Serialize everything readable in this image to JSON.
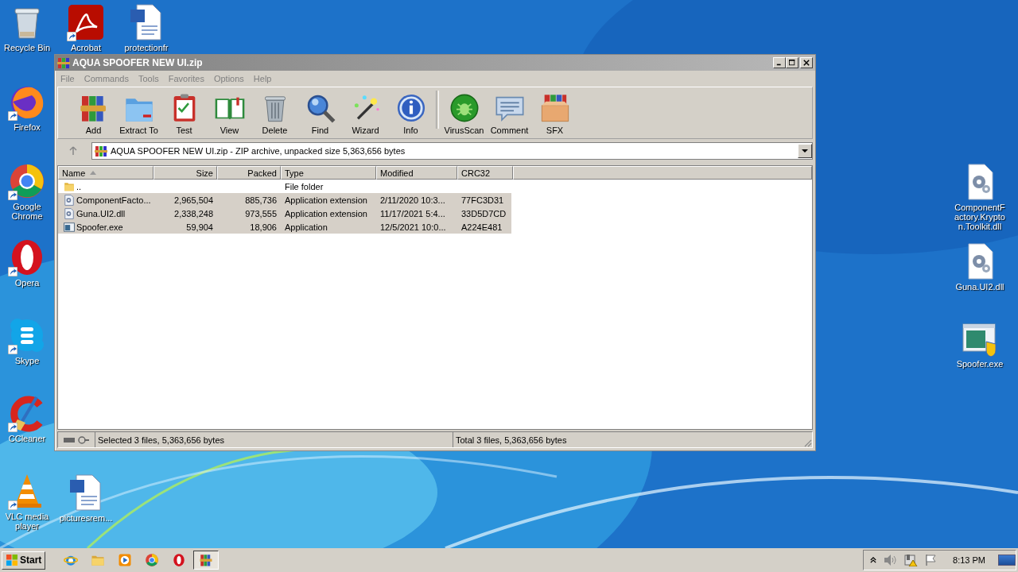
{
  "desktop": {
    "icons": [
      {
        "label": "Recycle Bin",
        "kind": "recycle",
        "shortcut": false
      },
      {
        "label": "Acrobat",
        "kind": "pdf",
        "shortcut": true
      },
      {
        "label": "protectionfr",
        "kind": "word",
        "shortcut": false
      },
      {
        "label": "Firefox",
        "kind": "firefox",
        "shortcut": true
      },
      {
        "label": "Google Chrome",
        "kind": "chrome",
        "shortcut": true
      },
      {
        "label": "Opera",
        "kind": "opera",
        "shortcut": true
      },
      {
        "label": "Skype",
        "kind": "skype",
        "shortcut": true
      },
      {
        "label": "CCleaner",
        "kind": "ccleaner",
        "shortcut": true
      },
      {
        "label": "VLC media player",
        "kind": "vlc",
        "shortcut": true
      },
      {
        "label": "picturesrem...",
        "kind": "word",
        "shortcut": false
      },
      {
        "label": "ComponentFactory.Krypton.Toolkit.dll",
        "kind": "dll",
        "shortcut": false
      },
      {
        "label": "Guna.UI2.dll",
        "kind": "dll",
        "shortcut": false
      },
      {
        "label": "Spoofer.exe",
        "kind": "exe",
        "shortcut": false
      }
    ]
  },
  "window": {
    "title": "AQUA SPOOFER NEW UI.zip",
    "menu": [
      "File",
      "Commands",
      "Tools",
      "Favorites",
      "Options",
      "Help"
    ],
    "toolbar": [
      {
        "label": "Add",
        "kind": "add"
      },
      {
        "label": "Extract To",
        "kind": "extract"
      },
      {
        "label": "Test",
        "kind": "test"
      },
      {
        "label": "View",
        "kind": "view"
      },
      {
        "label": "Delete",
        "kind": "delete"
      },
      {
        "label": "Find",
        "kind": "find"
      },
      {
        "label": "Wizard",
        "kind": "wizard"
      },
      {
        "label": "Info",
        "kind": "info"
      },
      {
        "label": "VirusScan",
        "kind": "virus"
      },
      {
        "label": "Comment",
        "kind": "comment"
      },
      {
        "label": "SFX",
        "kind": "sfx"
      }
    ],
    "address": "AQUA SPOOFER NEW UI.zip - ZIP archive, unpacked size 5,363,656 bytes",
    "columns": [
      {
        "label": "Name",
        "sorted": true
      },
      {
        "label": "Size",
        "sorted": false
      },
      {
        "label": "Packed",
        "sorted": false
      },
      {
        "label": "Type",
        "sorted": false
      },
      {
        "label": "Modified",
        "sorted": false
      },
      {
        "label": "CRC32",
        "sorted": false
      }
    ],
    "rows": [
      {
        "kind": "folder",
        "name": "..",
        "size": "",
        "packed": "",
        "type": "File folder",
        "modified": "",
        "crc": "",
        "selected": false
      },
      {
        "kind": "dll",
        "name": "ComponentFacto...",
        "size": "2,965,504",
        "packed": "885,736",
        "type": "Application extension",
        "modified": "2/11/2020 10:3...",
        "crc": "77FC3D31",
        "selected": true
      },
      {
        "kind": "dll",
        "name": "Guna.UI2.dll",
        "size": "2,338,248",
        "packed": "973,555",
        "type": "Application extension",
        "modified": "11/17/2021 5:4...",
        "crc": "33D5D7CD",
        "selected": true
      },
      {
        "kind": "exe",
        "name": "Spoofer.exe",
        "size": "59,904",
        "packed": "18,906",
        "type": "Application",
        "modified": "12/5/2021 10:0...",
        "crc": "A224E481",
        "selected": true
      }
    ],
    "status_left": "Selected 3 files, 5,363,656 bytes",
    "status_right": "Total 3 files, 5,363,656 bytes"
  },
  "taskbar": {
    "start": "Start",
    "apps": [
      {
        "kind": "ie",
        "active": false
      },
      {
        "kind": "explorer",
        "active": false
      },
      {
        "kind": "media",
        "active": false
      },
      {
        "kind": "chrome",
        "active": false
      },
      {
        "kind": "opera",
        "active": false
      },
      {
        "kind": "winrar",
        "active": true
      }
    ],
    "time": "8:13 PM"
  }
}
